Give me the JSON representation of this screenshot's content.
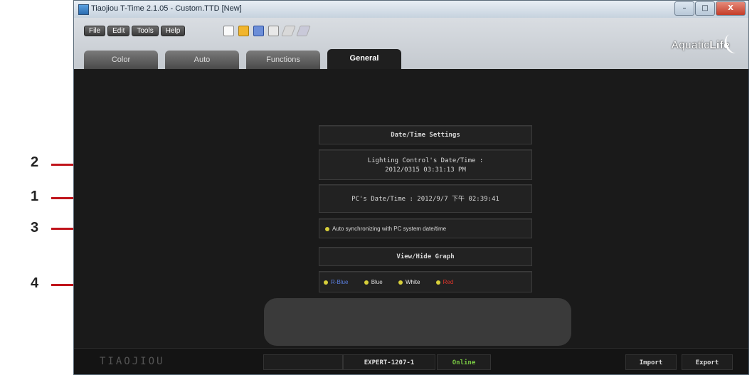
{
  "window": {
    "title": "Tiaojiou T-Time 2.1.05 - Custom.TTD [New]",
    "controls": [
      "–",
      "□",
      "X"
    ]
  },
  "menu": [
    "File",
    "Edit",
    "Tools",
    "Help"
  ],
  "toolbar_icons": [
    "new-file-icon",
    "open-folder-icon",
    "save-icon",
    "eraser-icon",
    "pen-icon",
    "wand-icon"
  ],
  "logo": {
    "pre": "Aquatic",
    "bold": "Life"
  },
  "tabs": [
    "Color",
    "Auto",
    "Functions",
    "General"
  ],
  "active_tab": "General",
  "datetime": {
    "header": "Date/Time Settings",
    "lc_label": "Lighting Control's Date/Time :",
    "lc_value": "2012/0315 03:31:13 PM",
    "pc": "PC's Date/Time : 2012/9/7 下午 02:39:41",
    "sync": "Auto synchronizing with PC system date/time"
  },
  "graph": {
    "header": "View/Hide Graph",
    "legend": [
      {
        "label": "R-Blue",
        "color": "#5b7fe0"
      },
      {
        "label": "Blue",
        "color": "#d8d8d8"
      },
      {
        "label": "White",
        "color": "#e8e8e8"
      },
      {
        "label": "Red",
        "color": "#e0342a"
      }
    ]
  },
  "footer": {
    "brand": "TIAOJIOU",
    "model": "EXPERT-1207-1",
    "status": "Online",
    "import": "Import",
    "export": "Export"
  },
  "callouts": [
    "2",
    "1",
    "3",
    "4"
  ],
  "colors": {
    "callout_red": "#c0141b",
    "online_green": "#79c943",
    "indicator_yellow": "#d7cf3a"
  }
}
